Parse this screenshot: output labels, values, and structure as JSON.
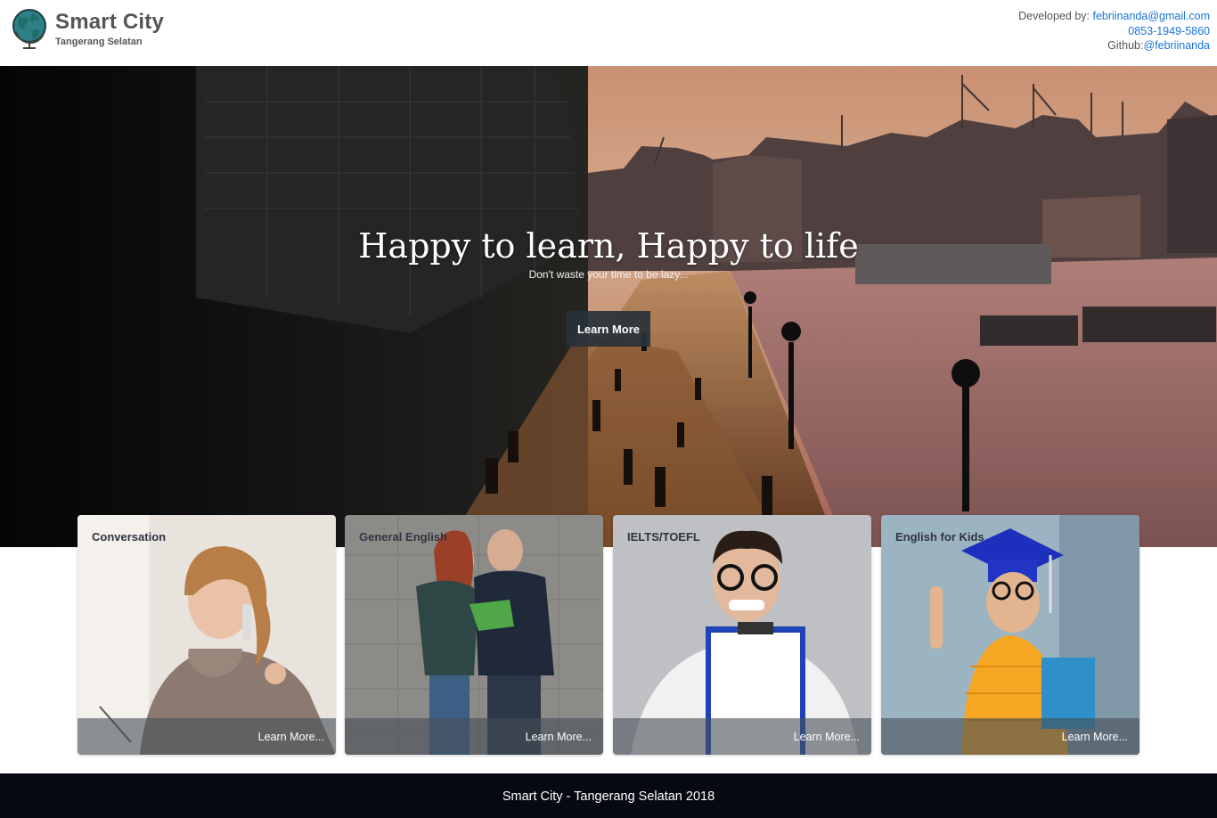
{
  "header": {
    "title": "Smart City",
    "subtitle": "Tangerang Selatan",
    "logo_icon": "globe-icon",
    "developer_label": "Developed by: ",
    "email": "febriinanda@gmail.com",
    "phone": "0853-1949-5860",
    "github_label": "Github:",
    "github_handle": "@febriinanda"
  },
  "hero": {
    "title": "Happy to learn, Happy to life",
    "subtitle": "Don't waste your time to be lazy...",
    "button_label": "Learn More"
  },
  "cards": [
    {
      "title": "Conversation",
      "link": "Learn More..."
    },
    {
      "title": "General English",
      "link": "Learn More..."
    },
    {
      "title": "IELTS/TOEFL",
      "link": "Learn More..."
    },
    {
      "title": "English for Kids",
      "link": "Learn More..."
    }
  ],
  "footer": {
    "text": "Smart City - Tangerang Selatan 2018"
  },
  "colors": {
    "link": "#1a73d6",
    "footer_bg": "#050a12",
    "button_bg": "#28323a"
  }
}
